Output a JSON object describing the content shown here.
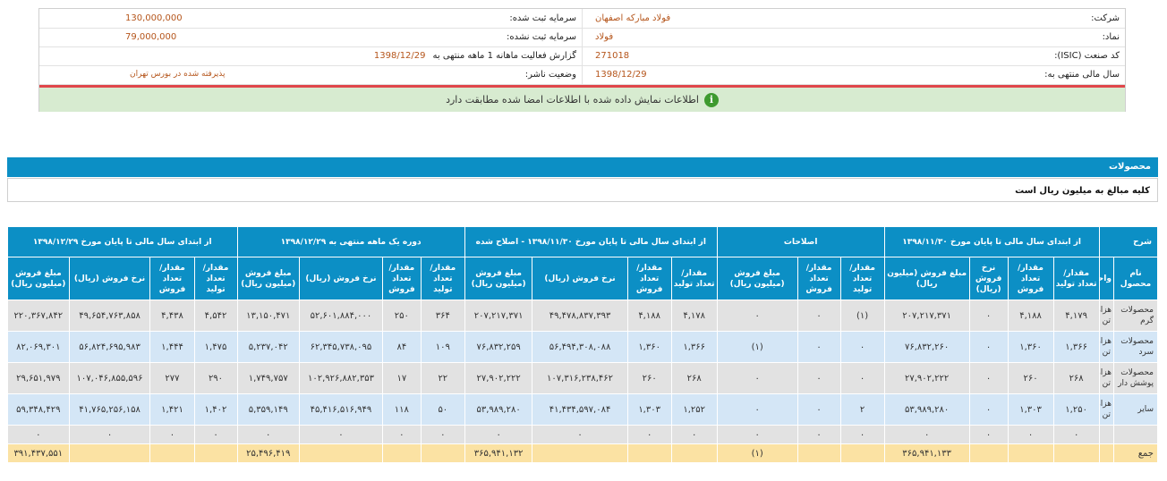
{
  "info": {
    "company_label": "شرکت:",
    "company_value": "فولاد مبارکه اصفهان",
    "registered_capital_label": "سرمایه ثبت شده:",
    "registered_capital_value": "130,000,000",
    "symbol_label": "نماد:",
    "symbol_value": "فولاد",
    "unregistered_capital_label": "سرمایه ثبت نشده:",
    "unregistered_capital_value": "79,000,000",
    "isic_label": "کد صنعت (ISIC):",
    "isic_value": "271018",
    "report_label": "گزارش فعالیت ماهانه 1 ماهه منتهی به",
    "report_value": "1398/12/29",
    "fiscal_year_label": "سال مالی منتهی به:",
    "fiscal_year_value": "1398/12/29",
    "publisher_status_label": "وضعیت ناشر:",
    "publisher_status_value": "پذیرفته شده در بورس تهران"
  },
  "notice": {
    "icon": "info-icon",
    "text": "اطلاعات نمایش داده شده با اطلاعات امضا شده مطابقت دارد"
  },
  "section": {
    "title": "محصولات",
    "subnote": "کلیه مبالغ به میلیون ریال است"
  },
  "table": {
    "group_headers": {
      "desc": "شرح",
      "g1": "از ابتدای سال مالی تا پایان مورخ ۱۳۹۸/۱۱/۳۰",
      "g2": "اصلاحات",
      "g3": "از ابتدای سال مالی تا پایان مورخ ۱۳۹۸/۱۱/۳۰ - اصلاح شده",
      "g4": "دوره یک ماهه منتهی به ۱۳۹۸/۱۲/۲۹",
      "g5": "از ابتدای سال مالی تا پایان مورخ ۱۳۹۸/۱۲/۲۹"
    },
    "sub_headers": {
      "name": "نام محصول",
      "unit": "واحد",
      "prod_qty": "مقدار/ تعداد تولید",
      "sale_qty": "مقدار/ تعداد فروش",
      "rate": "نرخ فروش (ریال)",
      "amount": "مبلغ فروش (میلیون ریال)"
    },
    "rows": [
      {
        "name": "محصولات گرم",
        "unit": "هزار تن",
        "c": [
          "۴,۱۷۹",
          "۴,۱۸۸",
          "۰",
          "۲۰۷,۲۱۷,۳۷۱",
          "(۱)",
          "۰",
          "۰",
          "۴,۱۷۸",
          "۴,۱۸۸",
          "۴۹,۴۷۸,۸۳۷,۳۹۳",
          "۲۰۷,۲۱۷,۳۷۱",
          "۳۶۴",
          "۲۵۰",
          "۵۲,۶۰۱,۸۸۴,۰۰۰",
          "۱۳,۱۵۰,۴۷۱",
          "۴,۵۴۲",
          "۴,۴۳۸",
          "۴۹,۶۵۴,۷۶۳,۸۵۸",
          "۲۲۰,۳۶۷,۸۴۲"
        ]
      },
      {
        "name": "محصولات سرد",
        "unit": "هزار تن",
        "c": [
          "۱,۳۶۶",
          "۱,۳۶۰",
          "۰",
          "۷۶,۸۳۲,۲۶۰",
          "۰",
          "۰",
          "(۱)",
          "۱,۳۶۶",
          "۱,۳۶۰",
          "۵۶,۴۹۴,۳۰۸,۰۸۸",
          "۷۶,۸۳۲,۲۵۹",
          "۱۰۹",
          "۸۴",
          "۶۲,۳۴۵,۷۳۸,۰۹۵",
          "۵,۲۳۷,۰۴۲",
          "۱,۴۷۵",
          "۱,۴۴۴",
          "۵۶,۸۲۴,۶۹۵,۹۸۳",
          "۸۲,۰۶۹,۳۰۱"
        ]
      },
      {
        "name": "محصولات پوشش دار",
        "unit": "هزار تن",
        "c": [
          "۲۶۸",
          "۲۶۰",
          "۰",
          "۲۷,۹۰۲,۲۲۲",
          "۰",
          "۰",
          "۰",
          "۲۶۸",
          "۲۶۰",
          "۱۰۷,۳۱۶,۲۳۸,۴۶۲",
          "۲۷,۹۰۲,۲۲۲",
          "۲۲",
          "۱۷",
          "۱۰۲,۹۲۶,۸۸۲,۳۵۳",
          "۱,۷۴۹,۷۵۷",
          "۲۹۰",
          "۲۷۷",
          "۱۰۷,۰۴۶,۸۵۵,۵۹۶",
          "۲۹,۶۵۱,۹۷۹"
        ]
      },
      {
        "name": "سایر",
        "unit": "هزار تن",
        "c": [
          "۱,۲۵۰",
          "۱,۳۰۳",
          "۰",
          "۵۳,۹۸۹,۲۸۰",
          "۲",
          "۰",
          "۰",
          "۱,۲۵۲",
          "۱,۳۰۳",
          "۴۱,۴۳۴,۵۹۷,۰۸۴",
          "۵۳,۹۸۹,۲۸۰",
          "۵۰",
          "۱۱۸",
          "۴۵,۴۱۶,۵۱۶,۹۴۹",
          "۵,۳۵۹,۱۴۹",
          "۱,۴۰۲",
          "۱,۴۲۱",
          "۴۱,۷۶۵,۲۵۶,۱۵۸",
          "۵۹,۳۴۸,۴۲۹"
        ]
      },
      {
        "name": "",
        "unit": "",
        "c": [
          "۰",
          "۰",
          "۰",
          "۰",
          "۰",
          "۰",
          "۰",
          "۰",
          "۰",
          "۰",
          "۰",
          "۰",
          "۰",
          "۰",
          "۰",
          "۰",
          "۰",
          "۰",
          "۰"
        ]
      }
    ],
    "total": {
      "label": "جمع",
      "amount_g1": "۳۶۵,۹۴۱,۱۳۳",
      "amount_g2": "(۱)",
      "amount_g3": "۳۶۵,۹۴۱,۱۳۲",
      "amount_g4": "۲۵,۴۹۶,۴۱۹",
      "amount_g5": "۳۹۱,۴۳۷,۵۵۱"
    }
  }
}
